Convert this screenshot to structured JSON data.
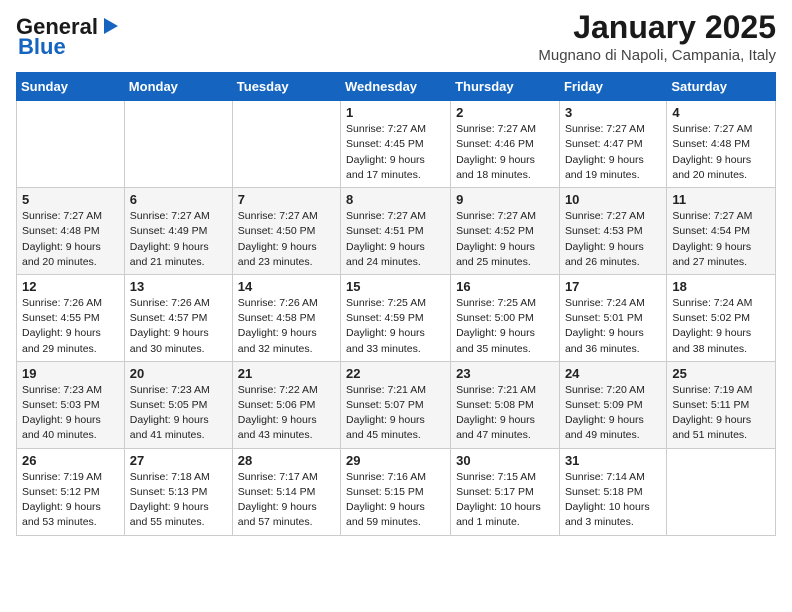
{
  "header": {
    "logo_general": "General",
    "logo_blue": "Blue",
    "month": "January 2025",
    "location": "Mugnano di Napoli, Campania, Italy"
  },
  "weekdays": [
    "Sunday",
    "Monday",
    "Tuesday",
    "Wednesday",
    "Thursday",
    "Friday",
    "Saturday"
  ],
  "weeks": [
    [
      {
        "day": "",
        "sunrise": "",
        "sunset": "",
        "daylight": ""
      },
      {
        "day": "",
        "sunrise": "",
        "sunset": "",
        "daylight": ""
      },
      {
        "day": "",
        "sunrise": "",
        "sunset": "",
        "daylight": ""
      },
      {
        "day": "1",
        "sunrise": "Sunrise: 7:27 AM",
        "sunset": "Sunset: 4:45 PM",
        "daylight": "Daylight: 9 hours and 17 minutes."
      },
      {
        "day": "2",
        "sunrise": "Sunrise: 7:27 AM",
        "sunset": "Sunset: 4:46 PM",
        "daylight": "Daylight: 9 hours and 18 minutes."
      },
      {
        "day": "3",
        "sunrise": "Sunrise: 7:27 AM",
        "sunset": "Sunset: 4:47 PM",
        "daylight": "Daylight: 9 hours and 19 minutes."
      },
      {
        "day": "4",
        "sunrise": "Sunrise: 7:27 AM",
        "sunset": "Sunset: 4:48 PM",
        "daylight": "Daylight: 9 hours and 20 minutes."
      }
    ],
    [
      {
        "day": "5",
        "sunrise": "Sunrise: 7:27 AM",
        "sunset": "Sunset: 4:48 PM",
        "daylight": "Daylight: 9 hours and 20 minutes."
      },
      {
        "day": "6",
        "sunrise": "Sunrise: 7:27 AM",
        "sunset": "Sunset: 4:49 PM",
        "daylight": "Daylight: 9 hours and 21 minutes."
      },
      {
        "day": "7",
        "sunrise": "Sunrise: 7:27 AM",
        "sunset": "Sunset: 4:50 PM",
        "daylight": "Daylight: 9 hours and 23 minutes."
      },
      {
        "day": "8",
        "sunrise": "Sunrise: 7:27 AM",
        "sunset": "Sunset: 4:51 PM",
        "daylight": "Daylight: 9 hours and 24 minutes."
      },
      {
        "day": "9",
        "sunrise": "Sunrise: 7:27 AM",
        "sunset": "Sunset: 4:52 PM",
        "daylight": "Daylight: 9 hours and 25 minutes."
      },
      {
        "day": "10",
        "sunrise": "Sunrise: 7:27 AM",
        "sunset": "Sunset: 4:53 PM",
        "daylight": "Daylight: 9 hours and 26 minutes."
      },
      {
        "day": "11",
        "sunrise": "Sunrise: 7:27 AM",
        "sunset": "Sunset: 4:54 PM",
        "daylight": "Daylight: 9 hours and 27 minutes."
      }
    ],
    [
      {
        "day": "12",
        "sunrise": "Sunrise: 7:26 AM",
        "sunset": "Sunset: 4:55 PM",
        "daylight": "Daylight: 9 hours and 29 minutes."
      },
      {
        "day": "13",
        "sunrise": "Sunrise: 7:26 AM",
        "sunset": "Sunset: 4:57 PM",
        "daylight": "Daylight: 9 hours and 30 minutes."
      },
      {
        "day": "14",
        "sunrise": "Sunrise: 7:26 AM",
        "sunset": "Sunset: 4:58 PM",
        "daylight": "Daylight: 9 hours and 32 minutes."
      },
      {
        "day": "15",
        "sunrise": "Sunrise: 7:25 AM",
        "sunset": "Sunset: 4:59 PM",
        "daylight": "Daylight: 9 hours and 33 minutes."
      },
      {
        "day": "16",
        "sunrise": "Sunrise: 7:25 AM",
        "sunset": "Sunset: 5:00 PM",
        "daylight": "Daylight: 9 hours and 35 minutes."
      },
      {
        "day": "17",
        "sunrise": "Sunrise: 7:24 AM",
        "sunset": "Sunset: 5:01 PM",
        "daylight": "Daylight: 9 hours and 36 minutes."
      },
      {
        "day": "18",
        "sunrise": "Sunrise: 7:24 AM",
        "sunset": "Sunset: 5:02 PM",
        "daylight": "Daylight: 9 hours and 38 minutes."
      }
    ],
    [
      {
        "day": "19",
        "sunrise": "Sunrise: 7:23 AM",
        "sunset": "Sunset: 5:03 PM",
        "daylight": "Daylight: 9 hours and 40 minutes."
      },
      {
        "day": "20",
        "sunrise": "Sunrise: 7:23 AM",
        "sunset": "Sunset: 5:05 PM",
        "daylight": "Daylight: 9 hours and 41 minutes."
      },
      {
        "day": "21",
        "sunrise": "Sunrise: 7:22 AM",
        "sunset": "Sunset: 5:06 PM",
        "daylight": "Daylight: 9 hours and 43 minutes."
      },
      {
        "day": "22",
        "sunrise": "Sunrise: 7:21 AM",
        "sunset": "Sunset: 5:07 PM",
        "daylight": "Daylight: 9 hours and 45 minutes."
      },
      {
        "day": "23",
        "sunrise": "Sunrise: 7:21 AM",
        "sunset": "Sunset: 5:08 PM",
        "daylight": "Daylight: 9 hours and 47 minutes."
      },
      {
        "day": "24",
        "sunrise": "Sunrise: 7:20 AM",
        "sunset": "Sunset: 5:09 PM",
        "daylight": "Daylight: 9 hours and 49 minutes."
      },
      {
        "day": "25",
        "sunrise": "Sunrise: 7:19 AM",
        "sunset": "Sunset: 5:11 PM",
        "daylight": "Daylight: 9 hours and 51 minutes."
      }
    ],
    [
      {
        "day": "26",
        "sunrise": "Sunrise: 7:19 AM",
        "sunset": "Sunset: 5:12 PM",
        "daylight": "Daylight: 9 hours and 53 minutes."
      },
      {
        "day": "27",
        "sunrise": "Sunrise: 7:18 AM",
        "sunset": "Sunset: 5:13 PM",
        "daylight": "Daylight: 9 hours and 55 minutes."
      },
      {
        "day": "28",
        "sunrise": "Sunrise: 7:17 AM",
        "sunset": "Sunset: 5:14 PM",
        "daylight": "Daylight: 9 hours and 57 minutes."
      },
      {
        "day": "29",
        "sunrise": "Sunrise: 7:16 AM",
        "sunset": "Sunset: 5:15 PM",
        "daylight": "Daylight: 9 hours and 59 minutes."
      },
      {
        "day": "30",
        "sunrise": "Sunrise: 7:15 AM",
        "sunset": "Sunset: 5:17 PM",
        "daylight": "Daylight: 10 hours and 1 minute."
      },
      {
        "day": "31",
        "sunrise": "Sunrise: 7:14 AM",
        "sunset": "Sunset: 5:18 PM",
        "daylight": "Daylight: 10 hours and 3 minutes."
      },
      {
        "day": "",
        "sunrise": "",
        "sunset": "",
        "daylight": ""
      }
    ]
  ]
}
